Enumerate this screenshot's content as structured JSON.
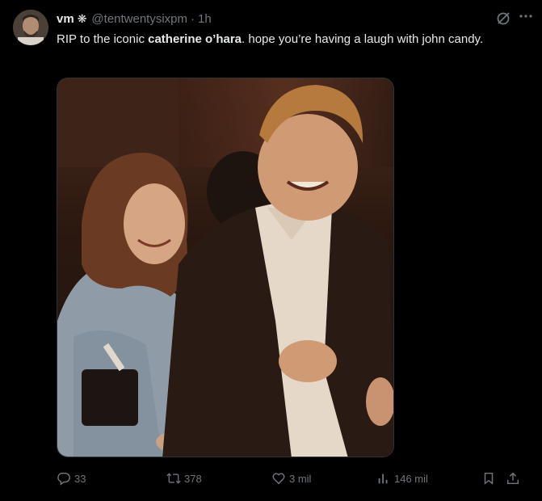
{
  "post": {
    "author_name": "vm",
    "author_badge": "❋",
    "handle": "@tentwentysixpm",
    "separator": "·",
    "time": "1h",
    "text_part1": "RIP to the iconic ",
    "text_bold": "catherine o’hara",
    "text_part2": ". hope you’re having a laugh with john candy."
  },
  "actions": {
    "replies": "33",
    "reposts": "378",
    "likes": "3 mil",
    "views": "146 mil"
  },
  "icons": {
    "grok": "grok-icon",
    "more": "more-icon",
    "reply": "reply-icon",
    "repost": "repost-icon",
    "like": "heart-icon",
    "views": "views-icon",
    "bookmark": "bookmark-icon",
    "share": "share-icon"
  },
  "colors": {
    "background": "#000000",
    "text": "#e7e9ea",
    "secondary": "#71767b"
  }
}
